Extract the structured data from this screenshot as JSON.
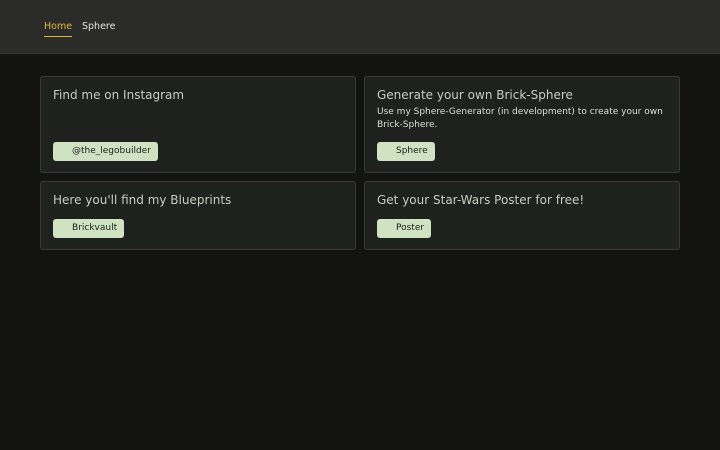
{
  "nav": {
    "items": [
      {
        "label": "Home",
        "active": true
      },
      {
        "label": "Sphere",
        "active": false
      }
    ],
    "accent_color": "#e3b53a"
  },
  "cards": [
    {
      "title": "Find me on Instagram",
      "text": "",
      "button_label": "@the_legobuilder"
    },
    {
      "title": "Generate your own Brick-Sphere",
      "text": "Use my Sphere-Generator (in development) to create your own Brick-Sphere.",
      "button_label": "Sphere"
    },
    {
      "title": "Here you'll find my Blueprints",
      "text": "",
      "button_label": "Brickvault"
    },
    {
      "title": "Get your Star-Wars Poster for free!",
      "text": "",
      "button_label": "Poster"
    }
  ],
  "colors": {
    "button_bg": "#cfe3c3",
    "card_bg": "#1f211e",
    "page_bg": "#131312",
    "topbar_bg": "#2b2c29"
  }
}
